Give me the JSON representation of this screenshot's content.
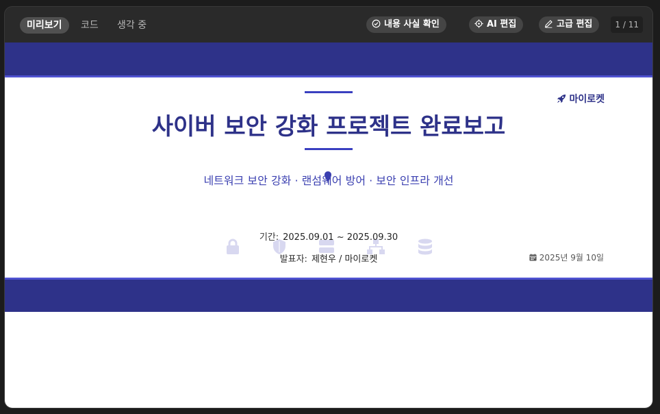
{
  "toolbar": {
    "tabs": [
      "미리보기",
      "코드",
      "생각 중"
    ],
    "fact_check_label": "내용 사실 확인",
    "ai_edit_label": "AI 편집",
    "advanced_edit_label": "고급 편집",
    "pager": "1 / 11"
  },
  "slide": {
    "brand": "마이로켓",
    "title": "사이버 보안 강화 프로젝트 완료보고",
    "subtitle": "네트워크 보안 강화 · 랜섬웨어 방어 · 보안 인프라 개선",
    "period_label": "기간:",
    "period_value": "2025.09.01 ~ 2025.09.30",
    "presenter_label": "발표자:",
    "presenter_value": "제현우 / 마이로켓",
    "date": "2025년 9월 10일",
    "colors": {
      "primary": "#2e3289",
      "accent": "#4f52d1",
      "deco": "#d8d8f0"
    }
  }
}
